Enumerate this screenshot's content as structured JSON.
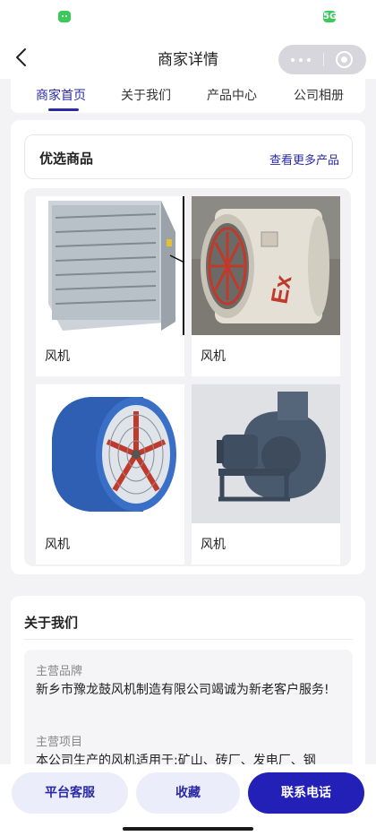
{
  "nav": {
    "title": "商家详情"
  },
  "status": {
    "signal_label": "5G"
  },
  "tabs": [
    {
      "label": "商家首页"
    },
    {
      "label": "关于我们"
    },
    {
      "label": "产品中心"
    },
    {
      "label": "公司相册"
    }
  ],
  "featured": {
    "title": "优选商品",
    "more_link": "查看更多产品",
    "products": [
      {
        "name": "风机",
        "image": "square-wall-exhaust-fan"
      },
      {
        "name": "风机",
        "image": "explosion-proof-axial-fan"
      },
      {
        "name": "风机",
        "image": "blue-axial-duct-fan"
      },
      {
        "name": "风机",
        "image": "centrifugal-blower"
      }
    ]
  },
  "about": {
    "title": "关于我们",
    "brand_label": "主营品牌",
    "brand_text": "新乡市豫龙鼓风机制造有限公司竭诚为新老客户服务!",
    "project_label": "主营项目",
    "project_text": "本公司生产的风机适用于:矿山、砖厂、发电厂、钢"
  },
  "bottom_bar": {
    "service_label": "平台客服",
    "favorite_label": "收藏",
    "contact_label": "联系电话"
  },
  "colors": {
    "accent": "#2b2aa6",
    "primary_button": "#2320b8",
    "light_button": "#ecedfb",
    "background": "#f3f3f6"
  }
}
